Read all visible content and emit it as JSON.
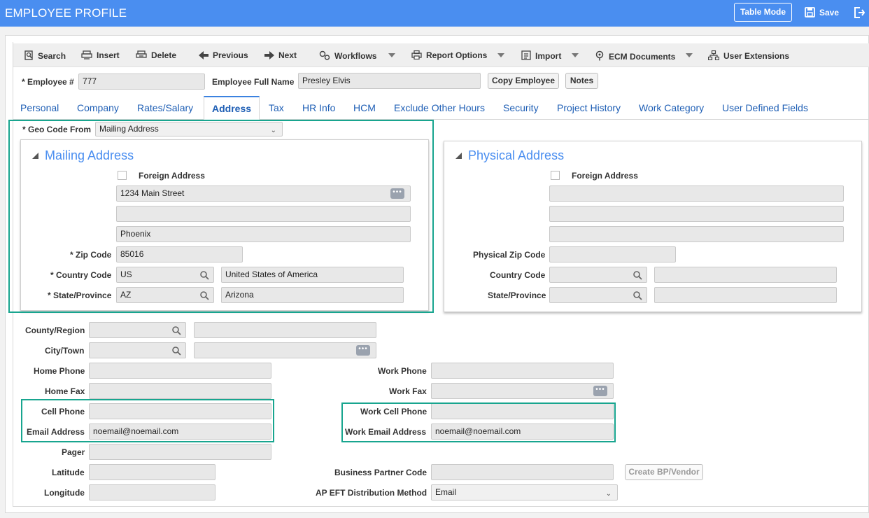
{
  "header": {
    "title": "EMPLOYEE PROFILE",
    "table_mode": "Table Mode",
    "save": "Save"
  },
  "toolbar": {
    "search": "Search",
    "insert": "Insert",
    "delete": "Delete",
    "previous": "Previous",
    "next": "Next",
    "workflows": "Workflows",
    "report_options": "Report Options",
    "import": "Import",
    "ecm_documents": "ECM Documents",
    "user_extensions": "User Extensions"
  },
  "employee": {
    "number_label": "* Employee #",
    "number_value": "777",
    "full_name_label": "Employee Full Name",
    "full_name_value": "Presley Elvis",
    "copy_employee": "Copy Employee",
    "notes": "Notes"
  },
  "tabs": [
    {
      "label": "Personal"
    },
    {
      "label": "Company"
    },
    {
      "label": "Rates/Salary"
    },
    {
      "label": "Address",
      "active": true
    },
    {
      "label": "Tax"
    },
    {
      "label": "HR Info"
    },
    {
      "label": "HCM"
    },
    {
      "label": "Exclude Other Hours"
    },
    {
      "label": "Security"
    },
    {
      "label": "Project History"
    },
    {
      "label": "Work Category"
    },
    {
      "label": "User Defined Fields"
    }
  ],
  "geo_code": {
    "label": "* Geo Code From",
    "value": "Mailing Address"
  },
  "mailing": {
    "title": "Mailing Address",
    "foreign_label": "Foreign Address",
    "line1": "1234 Main Street",
    "line2": "",
    "city": "Phoenix",
    "zip_label": "* Zip Code",
    "zip": "85016",
    "country_label": "* Country Code",
    "country_code": "US",
    "country_name": "United States of America",
    "state_label": "* State/Province",
    "state_code": "AZ",
    "state_name": "Arizona"
  },
  "physical": {
    "title": "Physical Address",
    "foreign_label": "Foreign Address",
    "zip_label": "Physical Zip Code",
    "country_label": "Country Code",
    "state_label": "State/Province"
  },
  "contact": {
    "county_label": "County/Region",
    "city_label": "City/Town",
    "home_phone_label": "Home Phone",
    "home_fax_label": "Home Fax",
    "cell_phone_label": "Cell Phone",
    "email_label": "Email Address",
    "email": "noemail@noemail.com",
    "pager_label": "Pager",
    "latitude_label": "Latitude",
    "longitude_label": "Longitude",
    "work_phone_label": "Work Phone",
    "work_fax_label": "Work Fax",
    "work_cell_label": "Work Cell Phone",
    "work_email_label": "Work Email Address",
    "work_email": "noemail@noemail.com",
    "bp_code_label": "Business Partner Code",
    "create_bp": "Create BP/Vendor",
    "ap_eft_label": "AP EFT Distribution Method",
    "ap_eft_value": "Email"
  },
  "colors": {
    "header_bg": "#4a8ef0",
    "highlight": "#18a58f",
    "tab_text": "#1f5fb5"
  }
}
